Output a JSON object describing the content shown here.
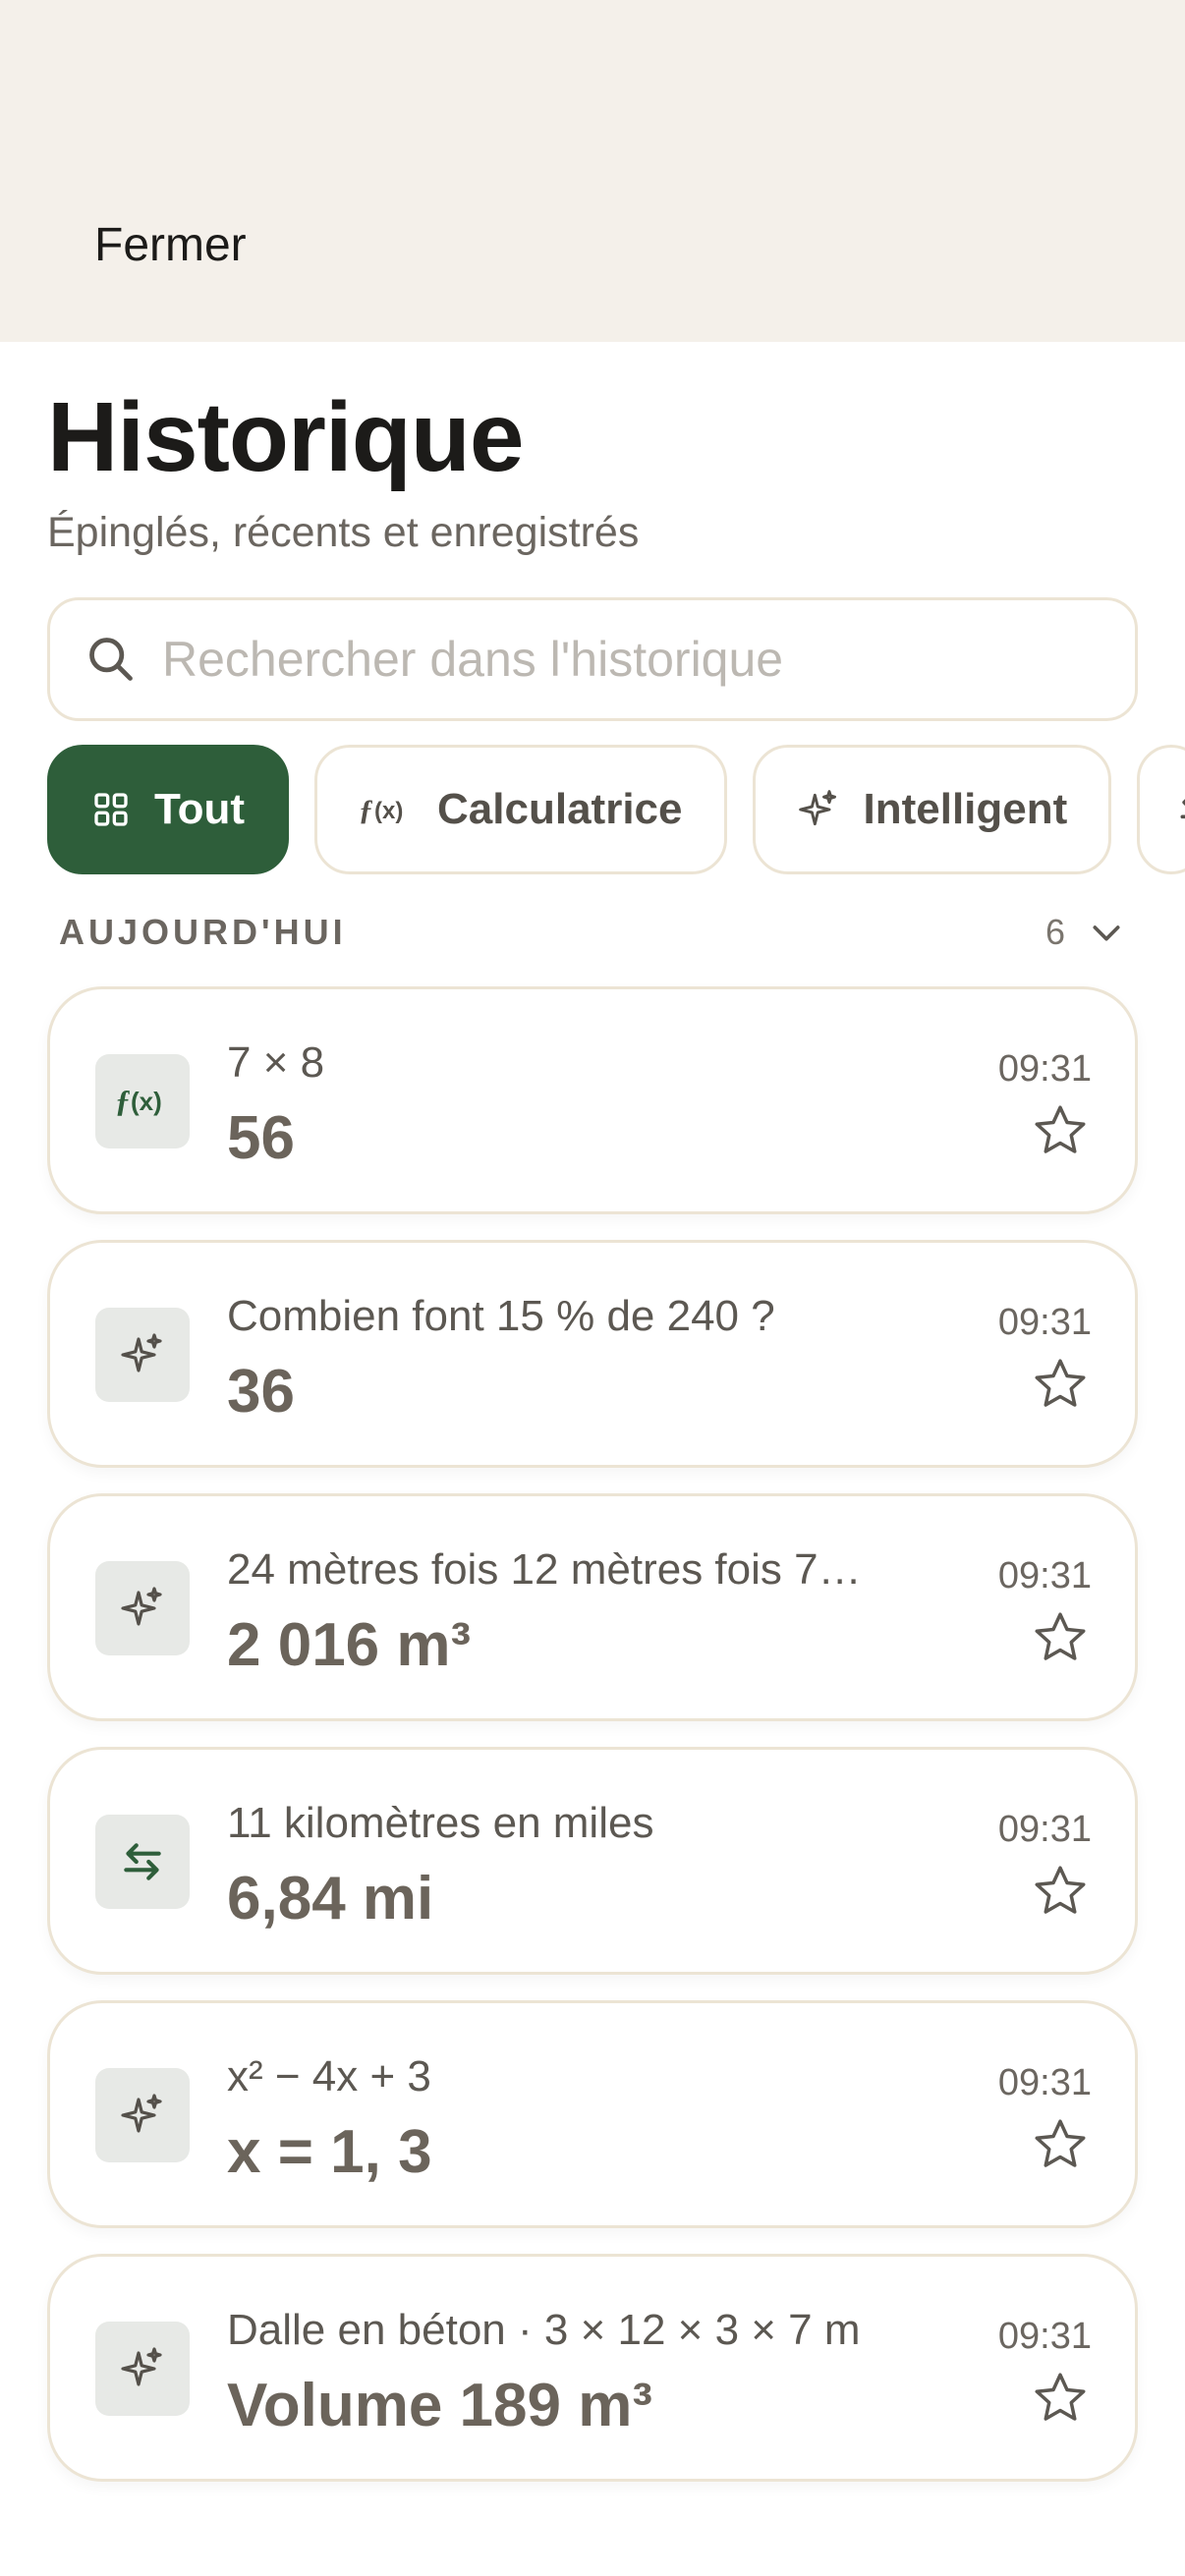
{
  "header": {
    "close_label": "Fermer",
    "title": "Historique",
    "subtitle": "Épinglés, récents et enregistrés"
  },
  "search": {
    "placeholder": "Rechercher dans l'historique",
    "value": "",
    "icon": "search-icon"
  },
  "filters": [
    {
      "label": "Tout",
      "icon": "grid-icon",
      "active": true
    },
    {
      "label": "Calculatrice",
      "icon": "function-icon",
      "active": false
    },
    {
      "label": "Intelligent",
      "icon": "sparkle-icon",
      "active": false
    },
    {
      "label": "",
      "icon": "convert-icon",
      "active": false
    }
  ],
  "section": {
    "label": "AUJOURD'HUI",
    "count": "6",
    "expand_icon": "chevron-down-icon"
  },
  "items": [
    {
      "query": "7 × 8",
      "result": "56",
      "time": "09:31",
      "icon": "function-icon"
    },
    {
      "query": "Combien font 15 % de 240 ?",
      "result": "36",
      "time": "09:31",
      "icon": "sparkle-icon"
    },
    {
      "query": "24 mètres fois 12 mètres fois 7…",
      "result": "2 016 m³",
      "time": "09:31",
      "icon": "sparkle-icon"
    },
    {
      "query": "11 kilomètres en miles",
      "result": "6,84 mi",
      "time": "09:31",
      "icon": "convert-icon"
    },
    {
      "query": "x² − 4x + 3",
      "result": "x = 1, 3",
      "time": "09:31",
      "icon": "sparkle-icon"
    },
    {
      "query": "Dalle en béton · 3 × 12 × 3 × 7 m",
      "result": "Volume 189 m³",
      "time": "09:31",
      "icon": "sparkle-icon"
    }
  ],
  "colors": {
    "accent": "#2e5e3a",
    "sheet_background": "#f4f0ea",
    "card_border": "#ece4d4"
  }
}
